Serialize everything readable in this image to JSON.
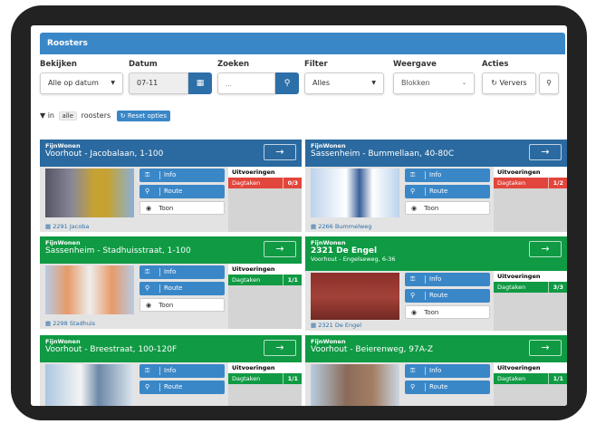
{
  "app": {
    "title": "Roosters"
  },
  "toolbar": {
    "bekijken": {
      "label": "Bekijken",
      "value": "Alle op datum"
    },
    "datum": {
      "label": "Datum",
      "value": "07-11"
    },
    "zoeken": {
      "label": "Zoeken",
      "placeholder": "..."
    },
    "filter": {
      "label": "Filter",
      "value": "Alles"
    },
    "weergave": {
      "label": "Weergave",
      "value": "Blokken"
    },
    "acties": {
      "label": "Acties",
      "ververs": "Ververs"
    }
  },
  "filterline": {
    "prefix": "in",
    "scope": "alle",
    "suffix": "roosters",
    "reset": "Reset opties"
  },
  "common": {
    "info": "Info",
    "route": "Route",
    "toon": "Toon",
    "uitvoeringen": "Uitvoeringen",
    "dagtaken": "Dagtaken"
  },
  "cards": [
    {
      "org": "FijnWonen",
      "title": "Voorhout - Jacobalaan, 1-100",
      "subtitle": "",
      "count": "0/3",
      "status": "red",
      "footer": "2291 Jacoba"
    },
    {
      "org": "FijnWonen",
      "title": "Sassenheim - Bummellaan, 40-80C",
      "subtitle": "",
      "count": "1/2",
      "status": "red",
      "footer": "2266 Bummelweg"
    },
    {
      "org": "FijnWonen",
      "title": "Sassenheim - Stadhuisstraat, 1-100",
      "subtitle": "",
      "count": "1/1",
      "status": "green",
      "footer": "2298 Stadhuis"
    },
    {
      "org": "FijnWonen",
      "title": "2321 De Engel",
      "subtitle": "Voorhout - Engelseweg, 6-36",
      "count": "3/3",
      "status": "green",
      "footer": "2321 De Engel"
    },
    {
      "org": "FijnWonen",
      "title": "Voorhout - Breestraat, 100-120F",
      "subtitle": "",
      "count": "1/1",
      "status": "green",
      "footer": ""
    },
    {
      "org": "FijnWonen",
      "title": "Voorhout - Beierenweg, 97A-Z",
      "subtitle": "",
      "count": "1/1",
      "status": "green",
      "footer": ""
    }
  ],
  "colors": {
    "header_blue": "#3a87c8",
    "card_blue": "#2a6aa0",
    "card_green": "#0f9a43",
    "alert_red": "#e2453b"
  }
}
